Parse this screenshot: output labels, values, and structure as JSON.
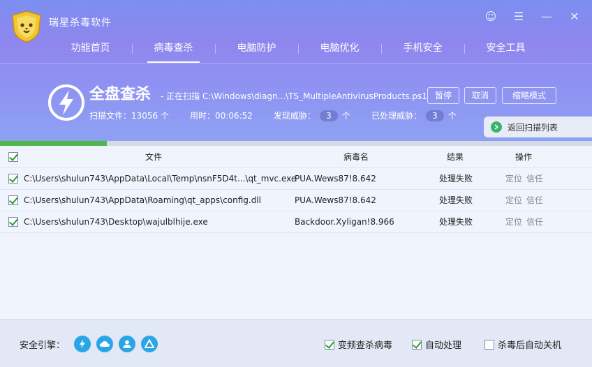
{
  "app": {
    "title": "瑞星杀毒软件"
  },
  "window_controls": [
    {
      "name": "user-icon",
      "glyph": "☺"
    },
    {
      "name": "menu-icon",
      "glyph": "☰"
    },
    {
      "name": "minimize-icon",
      "glyph": "—"
    },
    {
      "name": "close-icon",
      "glyph": "✕"
    }
  ],
  "nav": {
    "items": [
      {
        "label": "功能首页"
      },
      {
        "label": "病毒查杀",
        "active": true
      },
      {
        "label": "电脑防护"
      },
      {
        "label": "电脑优化"
      },
      {
        "label": "手机安全"
      },
      {
        "label": "安全工具"
      }
    ]
  },
  "scan": {
    "title": "全盘查杀",
    "status": "- 正在扫描 C:\\Windows\\diagn...\\TS_MultipleAntivirusProducts.ps1",
    "files_label": "扫描文件：13056 个",
    "time_label": "用时：00:06:52",
    "threats_label": "发现威胁：",
    "threats_count": "3",
    "threats_unit": "个",
    "handled_label": "已处理威胁：",
    "handled_count": "3",
    "handled_unit": "个",
    "progress": 0.18
  },
  "buttons": {
    "pause": "暂停",
    "cancel": "取消",
    "mini": "缩略模式",
    "back_list": "返回扫描列表"
  },
  "table": {
    "headers": {
      "file": "文件",
      "virus": "病毒名",
      "result": "结果",
      "action": "操作"
    },
    "rows": [
      {
        "file": "C:\\Users\\shulun743\\AppData\\Local\\Temp\\nsnF5D4t...\\qt_mvc.exe",
        "virus": "PUA.Wews87!8.642",
        "result": "处理失败",
        "locate": "定位",
        "trust": "信任"
      },
      {
        "file": "C:\\Users\\shulun743\\AppData\\Roaming\\qt_apps\\config.dll",
        "virus": "PUA.Wews87!8.642",
        "result": "处理失败",
        "locate": "定位",
        "trust": "信任"
      },
      {
        "file": "C:\\Users\\shulun743\\Desktop\\wajulblhije.exe",
        "virus": "Backdoor.Xyligan!8.966",
        "result": "处理失败",
        "locate": "定位",
        "trust": "信任"
      }
    ]
  },
  "footer": {
    "engine_label": "安全引擎：",
    "engines": [
      "lightning-engine-icon",
      "cloud-engine-icon",
      "user-engine-icon",
      "triangle-engine-icon"
    ],
    "options": [
      {
        "label": "变频查杀病毒",
        "checked": true
      },
      {
        "label": "自动处理",
        "checked": true
      },
      {
        "label": "杀毒后自动关机",
        "checked": false
      }
    ]
  },
  "colors": {
    "accent": "#8c90f0",
    "progress": "#4fb64a",
    "engine": "#2aa5e6"
  }
}
